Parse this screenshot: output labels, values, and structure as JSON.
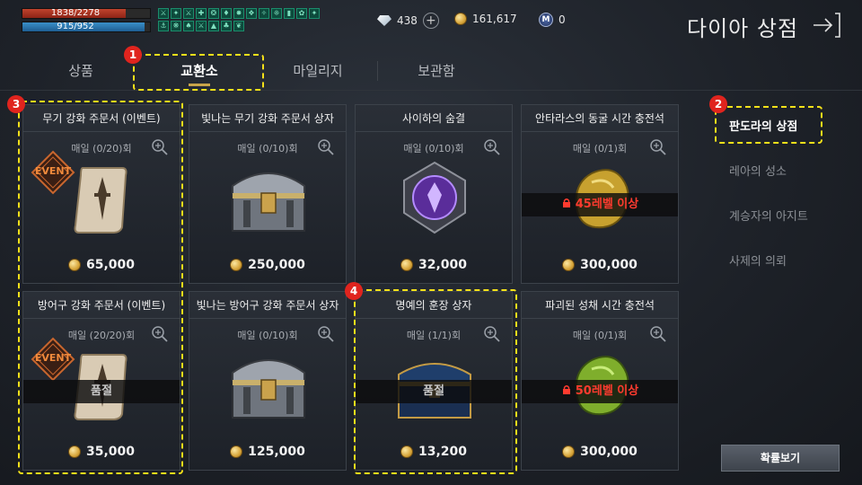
{
  "status": {
    "hp": "1838/2278",
    "hp_ratio": 0.807,
    "mp": "915/952",
    "mp_ratio": 0.961
  },
  "currency": {
    "diamond": "438",
    "gold": "161,617",
    "mileage": "0",
    "mileage_icon_letter": "M"
  },
  "header": {
    "title": "다이아 상점"
  },
  "tabs": [
    {
      "label": "상품"
    },
    {
      "label": "교환소"
    },
    {
      "label": "마일리지"
    },
    {
      "label": "보관함"
    }
  ],
  "markers": [
    "1",
    "2",
    "3",
    "4"
  ],
  "side_menu": [
    {
      "label": "판도라의 상점"
    },
    {
      "label": "레아의 성소"
    },
    {
      "label": "계승자의 아지트"
    },
    {
      "label": "사제의 의뢰"
    }
  ],
  "items": [
    {
      "title": "무기 강화 주문서 (이벤트)",
      "limit": "매일 (0/20)회",
      "price": "65,000",
      "event": "EVENT",
      "art": "scroll"
    },
    {
      "title": "빛나는 무기 강화 주문서 상자",
      "limit": "매일 (0/10)회",
      "price": "250,000",
      "art": "chest-silver"
    },
    {
      "title": "사이하의 숨결",
      "limit": "매일 (0/10)회",
      "price": "32,000",
      "art": "purple-gem"
    },
    {
      "title": "안타라스의 동굴 시간 충전석",
      "limit": "매일 (0/1)회",
      "price": "300,000",
      "band": "45레벨 이상",
      "band_type": "lock",
      "art": "gold-stone"
    },
    {
      "title": "방어구 강화 주문서 (이벤트)",
      "limit": "매일 (20/20)회",
      "price": "35,000",
      "event": "EVENT",
      "band": "품절",
      "band_type": "soldout",
      "art": "scroll"
    },
    {
      "title": "빛나는 방어구 강화 주문서 상자",
      "limit": "매일 (0/10)회",
      "price": "125,000",
      "art": "chest-silver"
    },
    {
      "title": "명예의 훈장 상자",
      "limit": "매일 (1/1)회",
      "price": "13,200",
      "band": "품절",
      "band_type": "soldout",
      "art": "chest-blue"
    },
    {
      "title": "파괴된 성채 시간 충전석",
      "limit": "매일 (0/1)회",
      "price": "300,000",
      "band": "50레벨 이상",
      "band_type": "lock",
      "art": "green-stone"
    }
  ],
  "probability_button": "확률보기",
  "colors": {
    "highlight": "#f5e11a",
    "marker": "#e0241e",
    "lock_text": "#ff3b2f"
  }
}
